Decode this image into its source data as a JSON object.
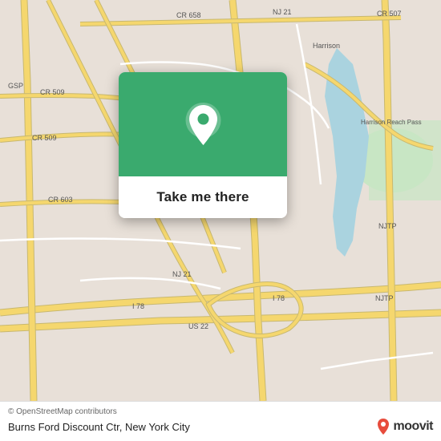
{
  "map": {
    "attribution": "© OpenStreetMap contributors",
    "background_color": "#e8e0d8"
  },
  "popup": {
    "button_label": "Take me there",
    "pin_icon": "📍"
  },
  "bottom_bar": {
    "copyright": "© OpenStreetMap contributors",
    "location_text": "Burns Ford Discount Ctr, New York City",
    "moovit_wordmark": "moovit"
  },
  "road_labels": [
    "CR 658",
    "NJ 21",
    "CR 507",
    "GSP",
    "CR 509",
    "CR 509",
    "CR 603",
    "Harrison",
    "Harrison Reach Pass",
    "NJ 21",
    "NJTP",
    "I 78",
    "NJ 21",
    "I 78",
    "US 22",
    "NJTP"
  ]
}
